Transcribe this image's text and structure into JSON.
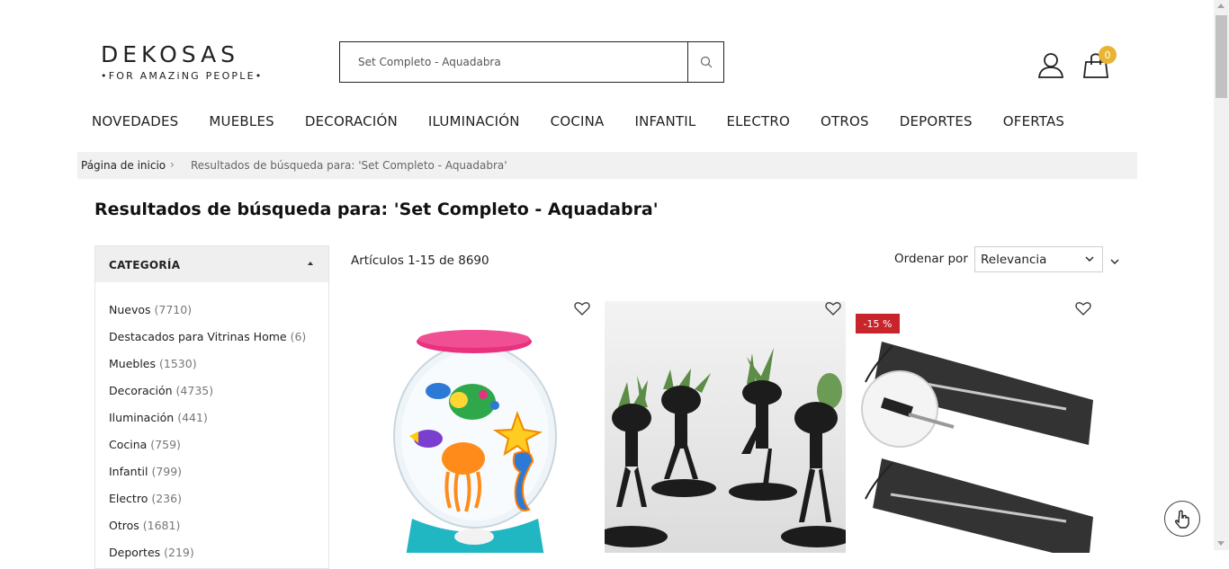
{
  "header": {
    "logo_main": "DEKOSAS",
    "logo_sub": "•FOR AMAZiNG PEOPLE•",
    "search_value": "Set Completo - Aquadabra",
    "cart_count": "0",
    "icons": [
      "search-icon",
      "user-icon",
      "cart-icon"
    ]
  },
  "nav": {
    "items": [
      "NOVEDADES",
      "MUEBLES",
      "DECORACIÓN",
      "ILUMINACIÓN",
      "COCINA",
      "INFANTIL",
      "ELECTRO",
      "OTROS",
      "DEPORTES",
      "OFERTAS"
    ]
  },
  "breadcrumb": {
    "home": "Página de inicio",
    "separator": "›",
    "current": "Resultados de búsqueda para: 'Set Completo - Aquadabra'"
  },
  "page_title": "Resultados de búsqueda para: 'Set Completo - Aquadabra'",
  "sidebar": {
    "heading": "CATEGORÍA",
    "categories": [
      {
        "name": "Nuevos",
        "count": "(7710)"
      },
      {
        "name": "Destacados para Vitrinas Home",
        "count": "(6)"
      },
      {
        "name": "Muebles",
        "count": "(1530)"
      },
      {
        "name": "Decoración",
        "count": "(4735)"
      },
      {
        "name": "Iluminación",
        "count": "(441)"
      },
      {
        "name": "Cocina",
        "count": "(759)"
      },
      {
        "name": "Infantil",
        "count": "(799)"
      },
      {
        "name": "Electro",
        "count": "(236)"
      },
      {
        "name": "Otros",
        "count": "(1681)"
      },
      {
        "name": "Deportes",
        "count": "(219)"
      }
    ]
  },
  "toolbar": {
    "count_text": "Artículos 1-15 de 8690",
    "sort_label": "Ordenar por",
    "sort_value": "Relevancia"
  },
  "products": [
    {
      "name": "aquadabra-fishbowl",
      "badge": ""
    },
    {
      "name": "planter-figures",
      "badge": ""
    },
    {
      "name": "straw-set",
      "badge": "-15 %"
    }
  ],
  "colors": {
    "accent_badge": "#c8242c",
    "cart_badge": "#e8b431",
    "breadcrumb_bg": "#f1f1f1"
  }
}
